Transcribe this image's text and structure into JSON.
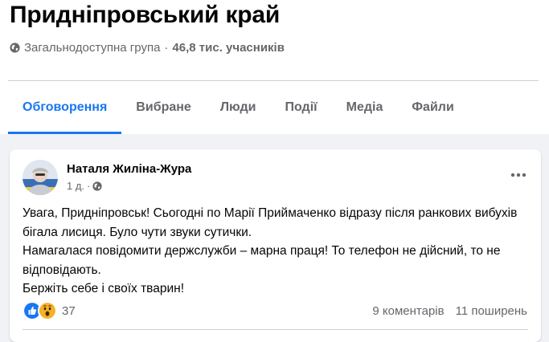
{
  "group": {
    "title": "Придніпровський край",
    "visibility": "Загальнодоступна група",
    "members": "46,8 тис. учасників"
  },
  "tabs": [
    {
      "label": "Обговорення",
      "active": true
    },
    {
      "label": "Вибране"
    },
    {
      "label": "Люди"
    },
    {
      "label": "Події"
    },
    {
      "label": "Медіа"
    },
    {
      "label": "Файли"
    }
  ],
  "post": {
    "author": "Наталя Жиліна-Жура",
    "time": "1 д.",
    "paragraphs": [
      "Увага, Придніпровськ! Сьогодні по Марії Приймаченко відразу після ранкових вибухів бігала лисиця. Було чути звуки сутички.",
      "Намагалася повідомити держслужби – марна праця! То телефон не дійсний, то не відповідають.",
      "Бержіть себе і своїх тварин!"
    ],
    "reaction_icons": [
      "like-icon",
      "wow-icon"
    ],
    "reaction_count": "37",
    "comments": "9 коментарів",
    "shares": "11 поширень"
  },
  "colors": {
    "accent": "#1877f2",
    "secondary_text": "#65676b",
    "page_bg": "#f0f2f5",
    "wow_yellow": "#f7b125"
  }
}
